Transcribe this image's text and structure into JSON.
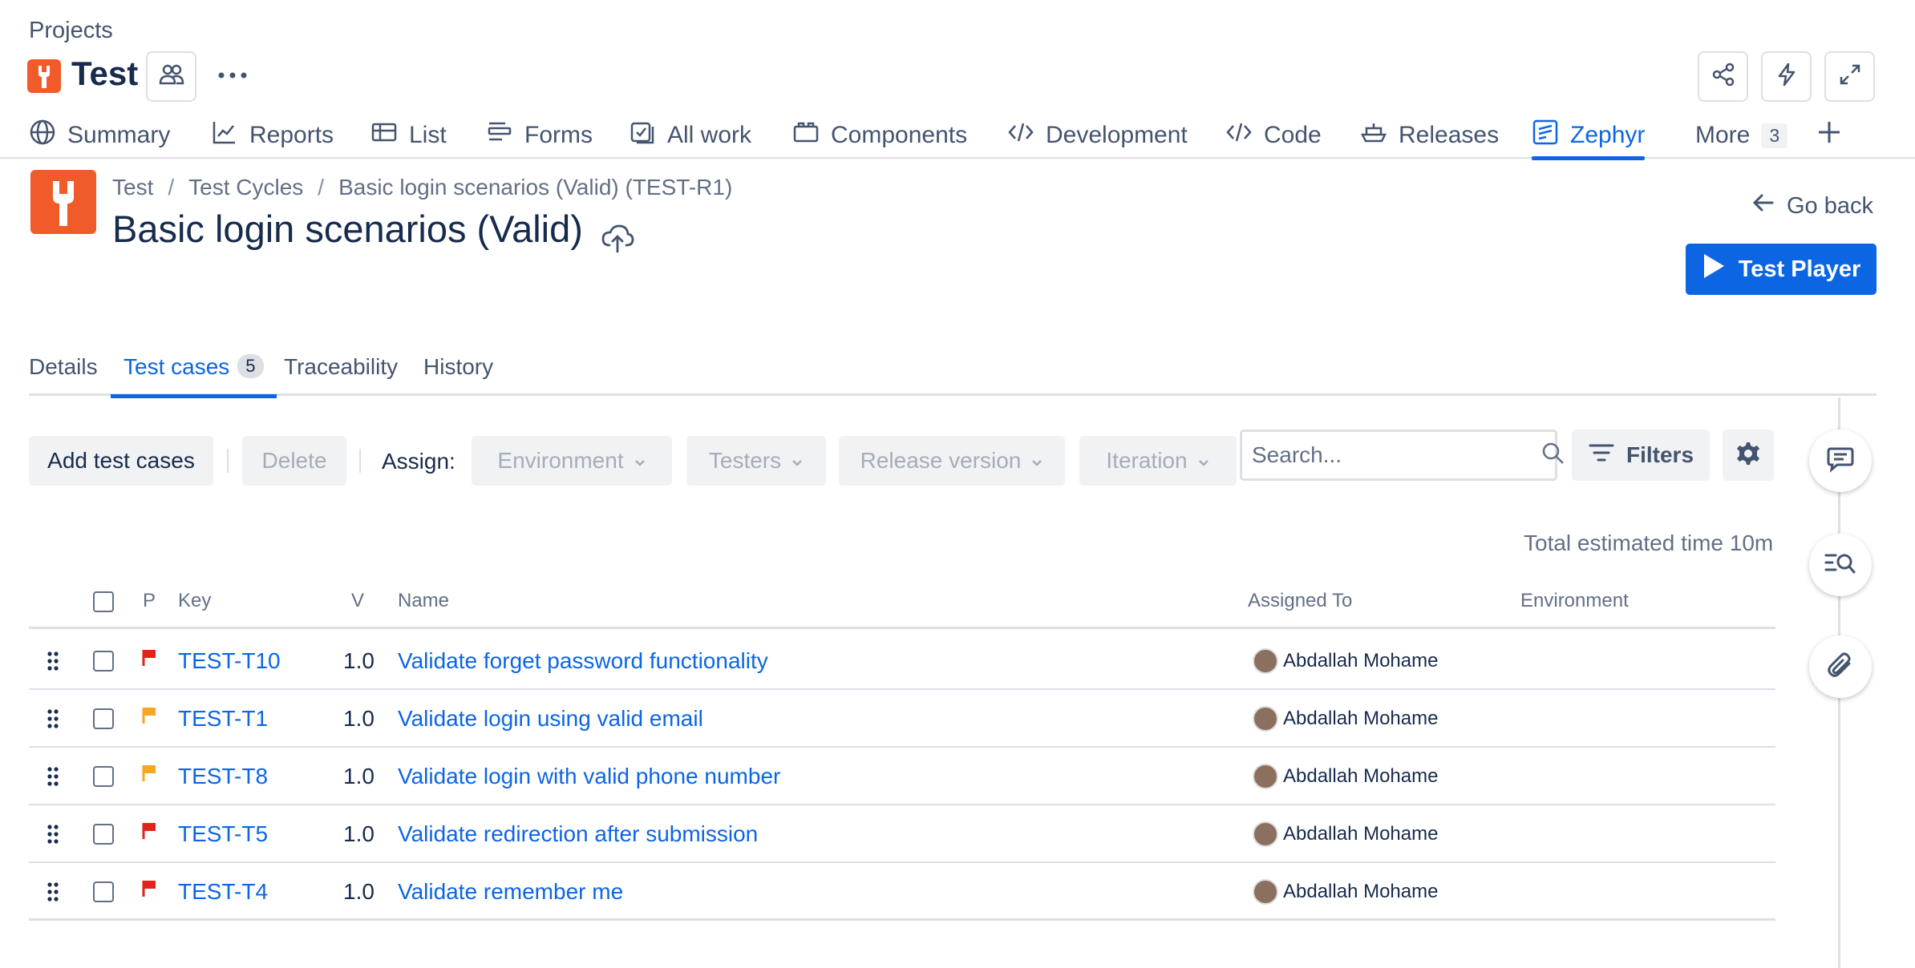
{
  "header": {
    "projects_label": "Projects",
    "project_name": "Test"
  },
  "nav": [
    {
      "label": "Summary",
      "icon": "globe-icon"
    },
    {
      "label": "Reports",
      "icon": "chart-line-icon"
    },
    {
      "label": "List",
      "icon": "list-table-icon"
    },
    {
      "label": "Forms",
      "icon": "forms-icon"
    },
    {
      "label": "All work",
      "icon": "checkbox-stack-icon"
    },
    {
      "label": "Components",
      "icon": "components-icon"
    },
    {
      "label": "Development",
      "icon": "code-icon"
    },
    {
      "label": "Code",
      "icon": "code-icon"
    },
    {
      "label": "Releases",
      "icon": "ship-icon"
    },
    {
      "label": "Zephyr",
      "icon": "zephyr-icon",
      "active": true
    },
    {
      "label": "More",
      "badge": "3"
    }
  ],
  "breadcrumb": [
    "Test",
    "Test Cycles",
    "Basic login scenarios (Valid) (TEST-R1)"
  ],
  "cycle_title": "Basic login scenarios (Valid)",
  "go_back_label": "Go back",
  "test_player_label": "Test Player",
  "subtabs": {
    "details": "Details",
    "test_cases": "Test cases",
    "test_cases_count": "5",
    "traceability": "Traceability",
    "history": "History"
  },
  "toolbar": {
    "add_test_cases": "Add test cases",
    "delete": "Delete",
    "assign": "Assign:",
    "environment": "Environment",
    "testers": "Testers",
    "release_version": "Release version",
    "iteration": "Iteration",
    "search_placeholder": "Search...",
    "filters": "Filters"
  },
  "total_time": "Total estimated time 10m",
  "table": {
    "headers": {
      "p": "P",
      "key": "Key",
      "v": "V",
      "name": "Name",
      "assigned_to": "Assigned To",
      "environment": "Environment"
    },
    "rows": [
      {
        "priority_color": "#e2231a",
        "key": "TEST-T10",
        "version": "1.0",
        "name": "Validate forget password functionality",
        "assignee": "Abdallah Mohame",
        "environment": ""
      },
      {
        "priority_color": "#f5a623",
        "key": "TEST-T1",
        "version": "1.0",
        "name": "Validate login using valid email",
        "assignee": "Abdallah Mohame",
        "environment": ""
      },
      {
        "priority_color": "#f5a623",
        "key": "TEST-T8",
        "version": "1.0",
        "name": "Validate login with valid phone number",
        "assignee": "Abdallah Mohame",
        "environment": ""
      },
      {
        "priority_color": "#e2231a",
        "key": "TEST-T5",
        "version": "1.0",
        "name": "Validate redirection after submission",
        "assignee": "Abdallah Mohame",
        "environment": ""
      },
      {
        "priority_color": "#e2231a",
        "key": "TEST-T4",
        "version": "1.0",
        "name": "Validate remember me",
        "assignee": "Abdallah Mohame",
        "environment": ""
      }
    ]
  },
  "colors": {
    "accent": "#0c66e4",
    "brand": "#f15a29",
    "priority_high": "#e2231a",
    "priority_medium": "#f5a623"
  }
}
